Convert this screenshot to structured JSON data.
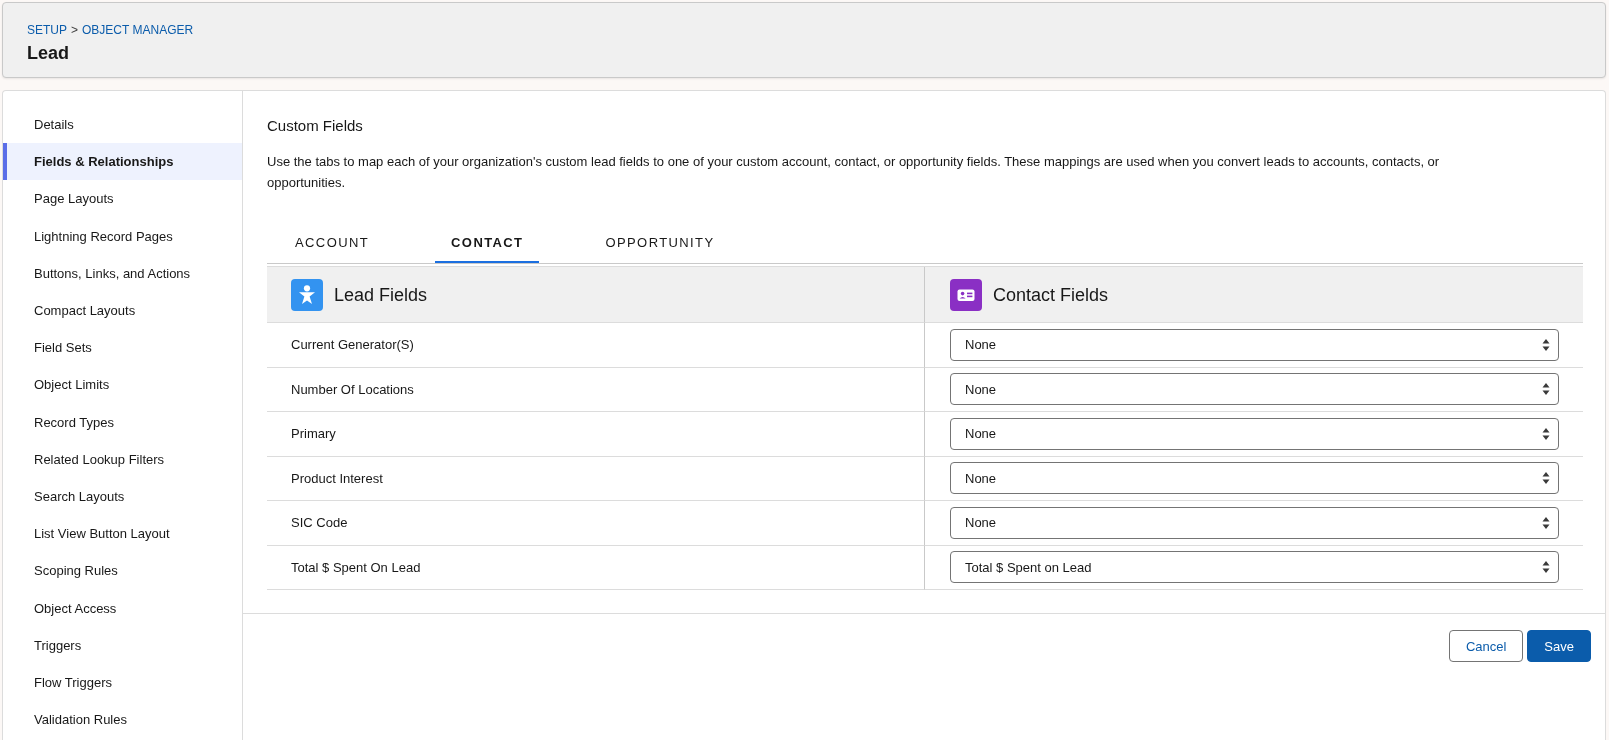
{
  "breadcrumb": {
    "links": [
      "SETUP",
      "OBJECT MANAGER"
    ],
    "separator": ">"
  },
  "page_title": "Lead",
  "sidebar": {
    "items": [
      {
        "label": "Details",
        "selected": false
      },
      {
        "label": "Fields & Relationships",
        "selected": true
      },
      {
        "label": "Page Layouts",
        "selected": false
      },
      {
        "label": "Lightning Record Pages",
        "selected": false
      },
      {
        "label": "Buttons, Links, and Actions",
        "selected": false
      },
      {
        "label": "Compact Layouts",
        "selected": false
      },
      {
        "label": "Field Sets",
        "selected": false
      },
      {
        "label": "Object Limits",
        "selected": false
      },
      {
        "label": "Record Types",
        "selected": false
      },
      {
        "label": "Related Lookup Filters",
        "selected": false
      },
      {
        "label": "Search Layouts",
        "selected": false
      },
      {
        "label": "List View Button Layout",
        "selected": false
      },
      {
        "label": "Scoping Rules",
        "selected": false
      },
      {
        "label": "Object Access",
        "selected": false
      },
      {
        "label": "Triggers",
        "selected": false
      },
      {
        "label": "Flow Triggers",
        "selected": false
      },
      {
        "label": "Validation Rules",
        "selected": false
      }
    ]
  },
  "section": {
    "title": "Custom Fields",
    "description": "Use the tabs to map each of your organization's custom lead fields to one of your custom account, contact, or opportunity fields. These mappings are used when you convert leads to accounts, contacts, or opportunities."
  },
  "tabs": [
    {
      "label": "ACCOUNT",
      "selected": false
    },
    {
      "label": "CONTACT",
      "selected": true
    },
    {
      "label": "OPPORTUNITY",
      "selected": false
    }
  ],
  "mapping_table": {
    "columns": [
      {
        "label": "Lead Fields",
        "kind": "lead"
      },
      {
        "label": "Contact Fields",
        "kind": "contact"
      }
    ],
    "rows": [
      {
        "lead_field": "Current Generator(S)",
        "value": "None"
      },
      {
        "lead_field": "Number Of Locations",
        "value": "None"
      },
      {
        "lead_field": "Primary",
        "value": "None"
      },
      {
        "lead_field": "Product Interest",
        "value": "None"
      },
      {
        "lead_field": "SIC Code",
        "value": "None"
      },
      {
        "lead_field": "Total $ Spent On Lead",
        "value": "Total $ Spent on Lead"
      }
    ]
  },
  "buttons": [
    {
      "label": "Cancel",
      "kind": "neutral"
    },
    {
      "label": "Save",
      "kind": "brand"
    }
  ]
}
